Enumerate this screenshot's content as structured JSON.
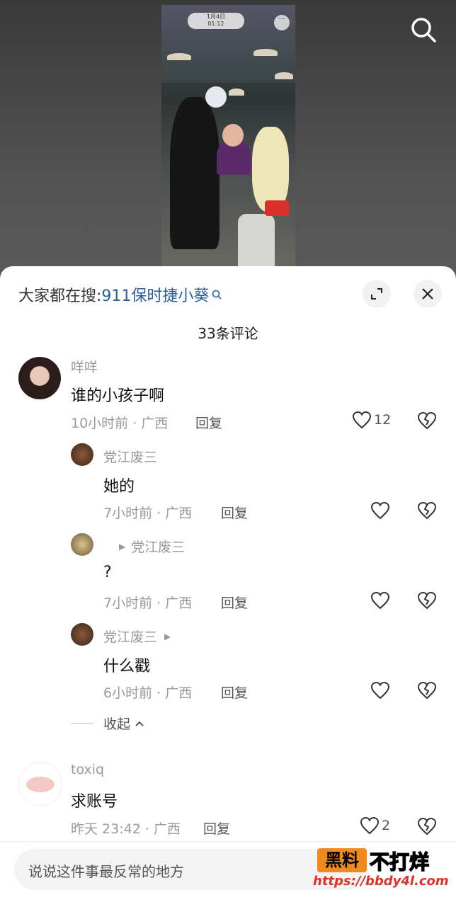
{
  "video": {
    "date": "1月4日",
    "time": "01:12"
  },
  "search_hint": {
    "prefix": "大家都在搜:",
    "keyword": "911保时捷小葵"
  },
  "comment_count": "33条评论",
  "comments": [
    {
      "user": "咩咩",
      "text": "谁的小孩子啊",
      "meta": "10小时前 · 广西",
      "reply": "回复",
      "likes": "12"
    },
    {
      "user": "党江废三",
      "text": "她的",
      "meta": "7小时前 · 广西",
      "reply": "回复"
    },
    {
      "user": "",
      "reply_to": "党江废三",
      "text": "?",
      "meta": "7小时前 · 广西",
      "reply": "回复"
    },
    {
      "user": "党江废三",
      "text": "什么戳",
      "meta": "6小时前 · 广西",
      "reply": "回复"
    },
    {
      "user": "toxiq",
      "text": "求账号",
      "meta": "昨天 23:42 · 广西",
      "reply": "回复",
      "likes": "2"
    }
  ],
  "collapse_label": "收起",
  "input_placeholder": "说说这件事最反常的地方",
  "watermark": {
    "box": "黑料",
    "text": "不打烊",
    "url": "https://bbdy4l.com"
  }
}
